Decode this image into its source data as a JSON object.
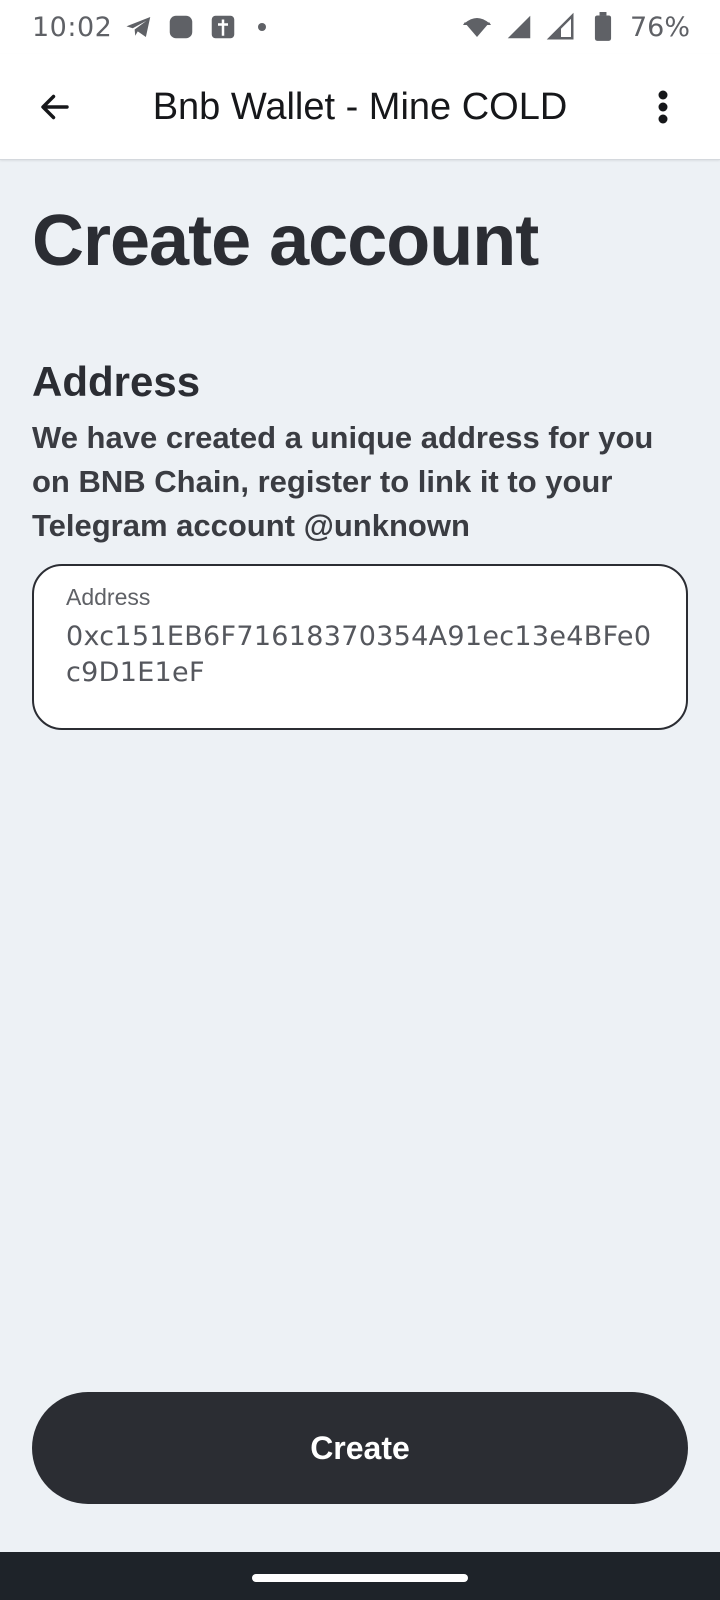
{
  "status_bar": {
    "time": "10:02",
    "battery": "76%",
    "icons": [
      "telegram-icon",
      "app-icon",
      "cross-icon",
      "notification-dot",
      "wifi-icon",
      "signal-icon",
      "signal-icon",
      "battery-icon"
    ]
  },
  "app_bar": {
    "title": "Bnb Wallet - Mine COLD",
    "back_icon": "arrow-left-icon",
    "menu_icon": "more-vertical-icon"
  },
  "page": {
    "title": "Create account"
  },
  "address_section": {
    "heading": "Address",
    "description": "We have created a unique address for you on BNB Chain, register to link it to your Telegram account @unknown",
    "field_label": "Address",
    "field_value": "0xc151EB6F71618370354A91ec13e4BFe0c9D1E1eF"
  },
  "actions": {
    "create_label": "Create"
  },
  "colors": {
    "background": "#edf1f5",
    "primary_button": "#2b2d33",
    "text": "#2b2d33"
  }
}
